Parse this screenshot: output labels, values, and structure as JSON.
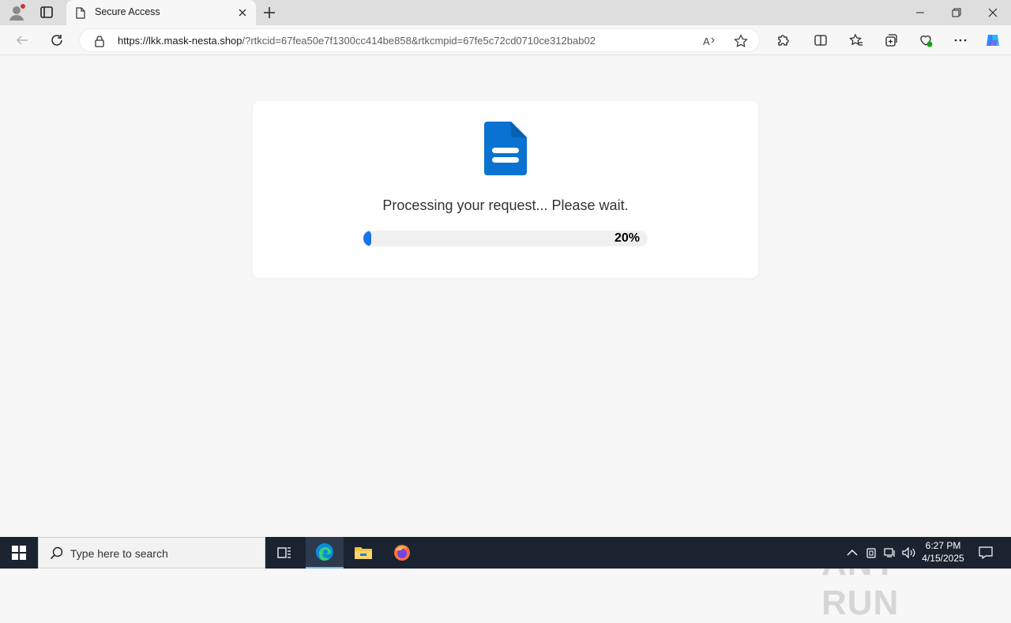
{
  "browser": {
    "tab_title": "Secure Access",
    "url_host": "https://lkk.mask-nesta.shop",
    "url_path": "/?rtkcid=67fea50e7f1300cc414be858&rtkcmpid=67fe5c72cd0710ce312bab02"
  },
  "page": {
    "message": "Processing your request... Please wait.",
    "progress_label": "20%",
    "progress_value": 0.02,
    "accent_color": "#1a73e8"
  },
  "watermark": {
    "text": "ANY RUN"
  },
  "taskbar": {
    "search_placeholder": "Type here to search",
    "time": "6:27 PM",
    "date": "4/15/2025"
  }
}
